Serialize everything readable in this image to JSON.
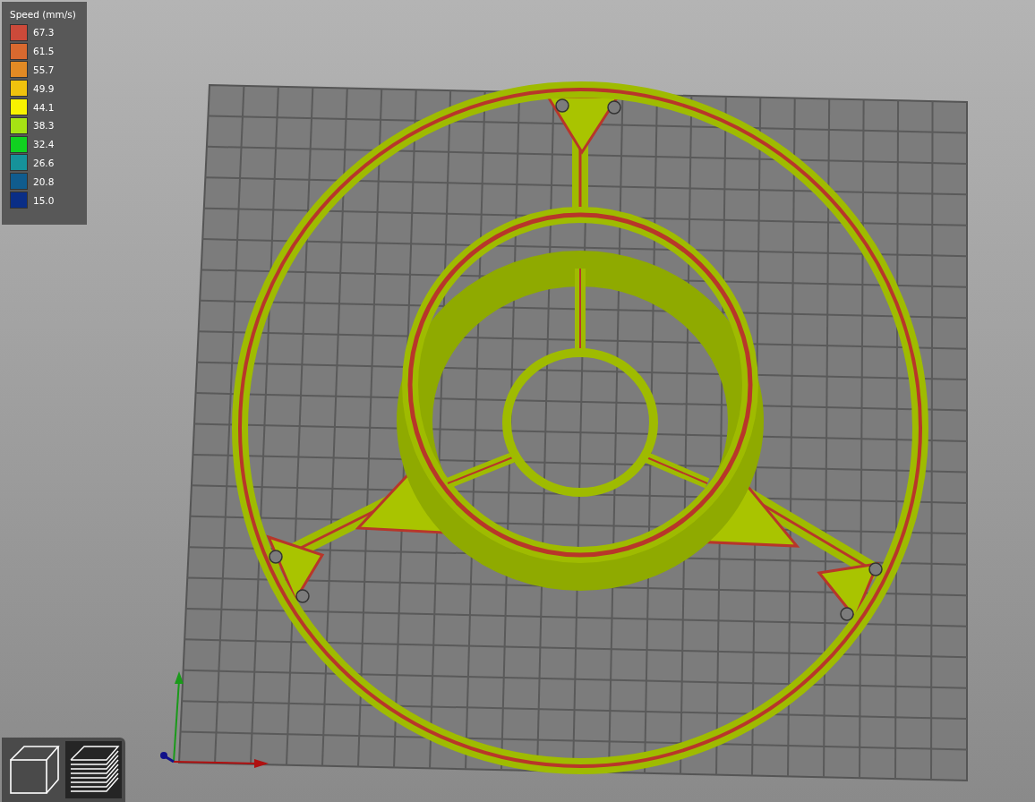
{
  "legend": {
    "title": "Speed (mm/s)",
    "items": [
      {
        "value": "67.3",
        "color": "#cc4a3a"
      },
      {
        "value": "61.5",
        "color": "#d8692f"
      },
      {
        "value": "55.7",
        "color": "#e28a24"
      },
      {
        "value": "49.9",
        "color": "#f0c20e"
      },
      {
        "value": "44.1",
        "color": "#f8f200"
      },
      {
        "value": "38.3",
        "color": "#a6e214"
      },
      {
        "value": "32.4",
        "color": "#10d120"
      },
      {
        "value": "26.6",
        "color": "#16929a"
      },
      {
        "value": "20.8",
        "color": "#105c8e"
      },
      {
        "value": "15.0",
        "color": "#0a2e86"
      }
    ]
  },
  "view_buttons": [
    {
      "kind": "solid",
      "selected": false
    },
    {
      "kind": "preview",
      "selected": true
    }
  ]
}
